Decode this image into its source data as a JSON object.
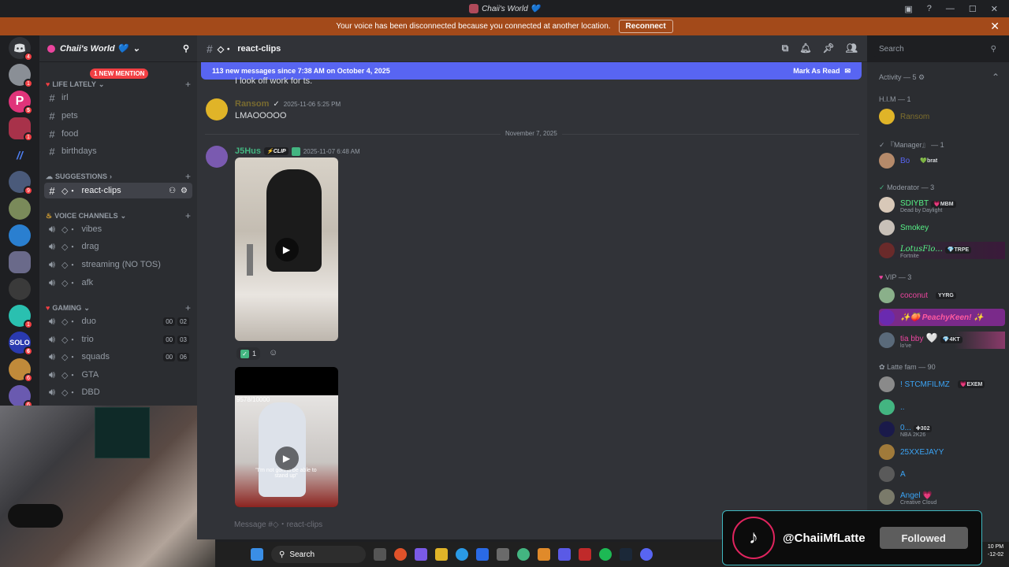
{
  "window": {
    "title": "Chaii's World 💙"
  },
  "voice_banner": {
    "message": "Your voice has been disconnected because you connected at another location.",
    "button": "Reconnect"
  },
  "server_badges": [
    "4",
    "1",
    "5",
    "1",
    "",
    "9",
    "",
    "",
    "",
    "",
    "1",
    "6",
    "6",
    "6",
    "6"
  ],
  "server": {
    "name": "Chaii's World 💙"
  },
  "mention_pill": "1 NEW MENTION",
  "categories": {
    "life_lately": "LIFE LATELY",
    "suggestions": "SUGGESTIONS",
    "voice": "VOICE CHANNELS",
    "gaming": "GAMING"
  },
  "text_channels": [
    "irl",
    "pets",
    "food",
    "birthdays"
  ],
  "active_channel": "react-clips",
  "voice_channels": [
    "vibes",
    "drag",
    "streaming (NO TOS)",
    "afk"
  ],
  "gaming_channels": [
    {
      "name": "duo",
      "a": "00",
      "b": "02"
    },
    {
      "name": "trio",
      "a": "00",
      "b": "03"
    },
    {
      "name": "squads",
      "a": "00",
      "b": "06"
    },
    {
      "name": "GTA"
    },
    {
      "name": "DBD"
    }
  ],
  "chat_header": {
    "channel": "react-clips"
  },
  "search": {
    "placeholder": "Search"
  },
  "new_messages": {
    "text": "113 new messages since 7:38 AM on October 4, 2025",
    "action": "Mark As Read"
  },
  "messages": {
    "partial": "I look off work for ts.",
    "m1": {
      "user": "Ransom",
      "time": "2025-11-06 5:25 PM",
      "text": "LMAOOOOO"
    },
    "divider": "November 7, 2025",
    "m2": {
      "user": "J5Hus",
      "tag": "CLIP",
      "time": "2025-11-07 6:48 AM",
      "reaction_count": "1",
      "video2_counter": "9578/10000",
      "video2_caption": "\"I'm not gonna be able to stand up\""
    }
  },
  "compose": {
    "placeholder": "Message #◇・react-clips"
  },
  "members": {
    "activity": "Activity — 5",
    "groups": [
      {
        "label": "H.I.M — 1",
        "members": [
          {
            "name": "Ransom",
            "color": "#b59a2a"
          }
        ]
      },
      {
        "label": "『Manager』 — 1",
        "members": [
          {
            "name": "Bo",
            "tag": "brat",
            "color": "#5865f2"
          }
        ]
      },
      {
        "label": "Moderator — 3",
        "members": [
          {
            "name": "SDIYBT",
            "tag": "MBM",
            "sub": "Dead by Daylight",
            "color": "#57f287"
          },
          {
            "name": "Smokey",
            "color": "#57f287"
          },
          {
            "name": "LotusFlo...",
            "tag": "TRPE",
            "sub": "Fortnite",
            "color": "#57f287"
          }
        ]
      },
      {
        "label": "VIP — 3",
        "members": [
          {
            "name": "coconut",
            "tag": "YRG",
            "color": "#eb459e"
          },
          {
            "name": "PeachyKeen!",
            "color": "#eb459e"
          },
          {
            "name": "tia bby",
            "tag": "4KT",
            "sub": "lo've",
            "color": "#eb459e"
          }
        ]
      },
      {
        "label": "Latte fam — 90",
        "members": [
          {
            "name": "! STCMFILMZ",
            "tag": "EXEM",
            "color": "#3ba4f5"
          },
          {
            "name": "..",
            "color": "#3ba4f5"
          },
          {
            "name": "0...",
            "tag": "302",
            "sub": "NBA 2K26",
            "color": "#3ba4f5"
          },
          {
            "name": "25XXEJAYY",
            "color": "#3ba4f5"
          },
          {
            "name": "A",
            "color": "#3ba4f5"
          },
          {
            "name": "Angel 💗",
            "sub": "Creative Cloud",
            "color": "#3ba4f5"
          }
        ]
      }
    ]
  },
  "taskbar": {
    "search": "Search",
    "time": "10 PM",
    "date": "-12-02"
  },
  "tiktok": {
    "handle": "@ChaiiMfLatte",
    "button": "Followed"
  },
  "colors": {
    "blurple": "#5865f2",
    "banner": "#a34a1a",
    "mention": "#f23f43"
  }
}
